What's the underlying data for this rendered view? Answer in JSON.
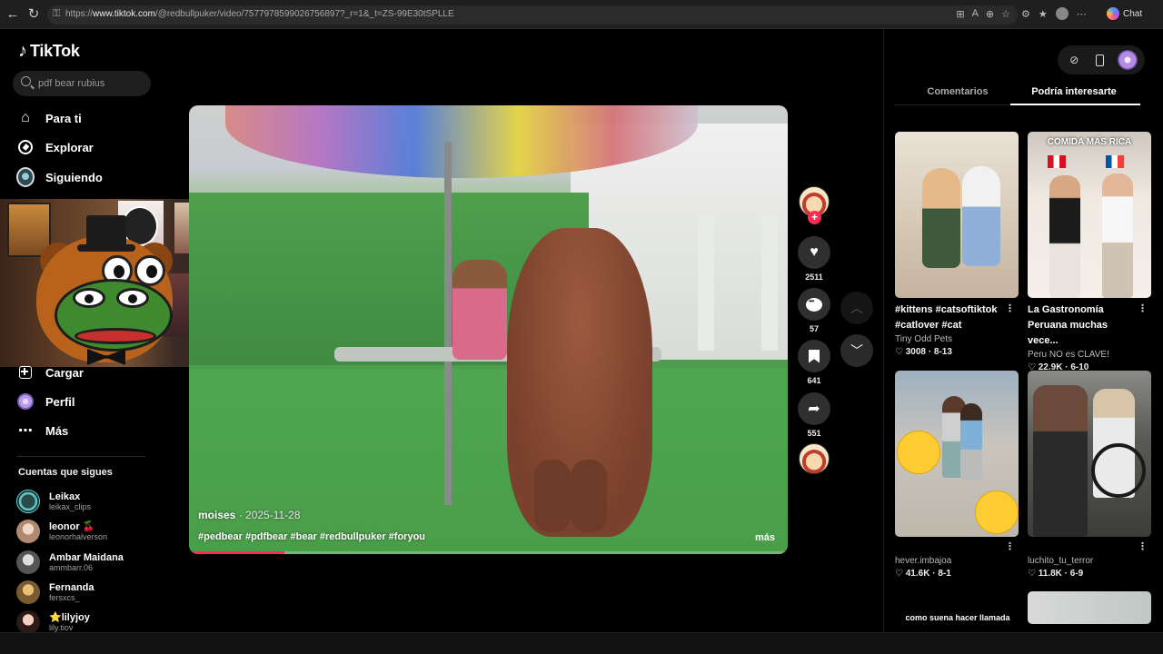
{
  "browser": {
    "url_prefix": "https://",
    "url_domain": "www.tiktok.com",
    "url_path": "/@redbullpuker/video/7577978599026756897?_r=1&_t=ZS-99E30tSPLLE",
    "chat_label": "Chat"
  },
  "app": {
    "logo_text": "TikTok"
  },
  "search": {
    "placeholder": "pdf bear rubius"
  },
  "nav": {
    "for_you": "Para ti",
    "explore": "Explorar",
    "following": "Siguiendo",
    "upload": "Cargar",
    "profile": "Perfil",
    "more": "Más"
  },
  "following_section": {
    "title": "Cuentas que sigues",
    "accounts": [
      {
        "name": "Leikax",
        "handle": "leikax_clips"
      },
      {
        "name": "leonor 🍒",
        "handle": "leonorhalverson"
      },
      {
        "name": "Ambar Maidana",
        "handle": "ammbarr.06"
      },
      {
        "name": "Fernanda",
        "handle": "fersxcs_"
      },
      {
        "name": "⭐lilyjoy",
        "handle": "lily.tiov"
      }
    ]
  },
  "video": {
    "author": "moises",
    "date": "· 2025-11-28",
    "caption": "#pedbear #pdfbear #bear #redbullpuker #foryou",
    "more_label": "más",
    "progress": 0.16
  },
  "actions": {
    "likes": "2511",
    "comments": "57",
    "saves": "641",
    "shares": "551"
  },
  "right_panel": {
    "tabs": [
      "Comentarios",
      "Podría interesarte"
    ],
    "active_tab": 1,
    "cards": [
      {
        "title": "#kittens #catsoftiktok #catlover #cat",
        "author": "Tiny Odd Pets",
        "stats": "♡ 3008 · 8-13"
      },
      {
        "title": "La Gastronomía Peruana muchas vece...",
        "author": "Peru NO es CLAVE!",
        "stats": "♡ 22.9K · 6-10",
        "banner": "COMIDA MÁS RICA"
      },
      {
        "title": "",
        "author": "hever.imbajoa",
        "stats": "♡ 41.6K · 8-1"
      },
      {
        "title": "",
        "author": "luchito_tu_terror",
        "stats": "♡ 11.8K · 6-9"
      }
    ],
    "next_caption": "como suena hacer llamada"
  },
  "colors": {
    "accent": "#fe2c55",
    "background": "#000000",
    "panel": "#1e1e1e"
  }
}
